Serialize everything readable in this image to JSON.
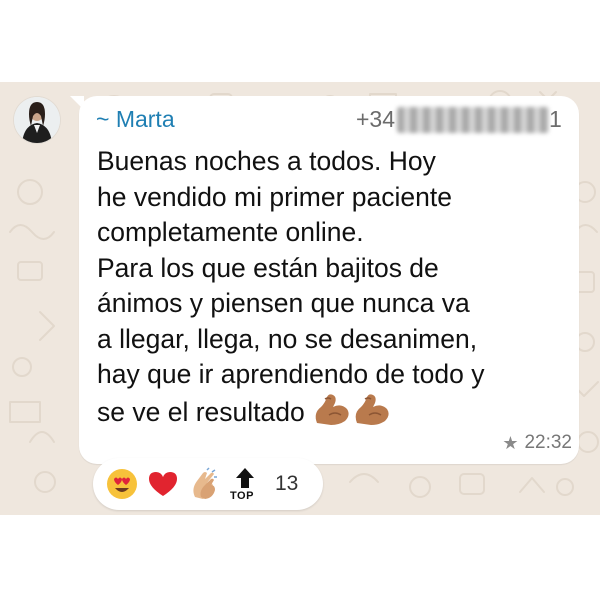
{
  "sender": {
    "name": "~ Marta",
    "phone_prefix": "+34",
    "phone_suffix": "1"
  },
  "message": {
    "text": "Buenas noches a todos. Hoy\nhe vendido mi primer paciente\ncompletamente online.\nPara los que están bajitos de\nánimos y piensen que nunca va\na llegar, llega, no se desanimen,\nhay que ir aprendiendo de todo y\nse ve el resultado",
    "trailing_emojis": [
      "flexed-biceps-icon",
      "flexed-biceps-icon"
    ],
    "time": "22:32",
    "starred": true
  },
  "reactions": {
    "items": [
      "heart-eyes-emoji-icon",
      "red-heart-emoji-icon",
      "clapping-hands-emoji-icon",
      "top-arrow-emoji-icon"
    ],
    "top_label": "TOP",
    "count": "13"
  },
  "colors": {
    "wallpaper": "#efe7de",
    "bubble": "#ffffff",
    "sender_name": "#1f7fb3",
    "text": "#111111",
    "meta": "#777777"
  }
}
